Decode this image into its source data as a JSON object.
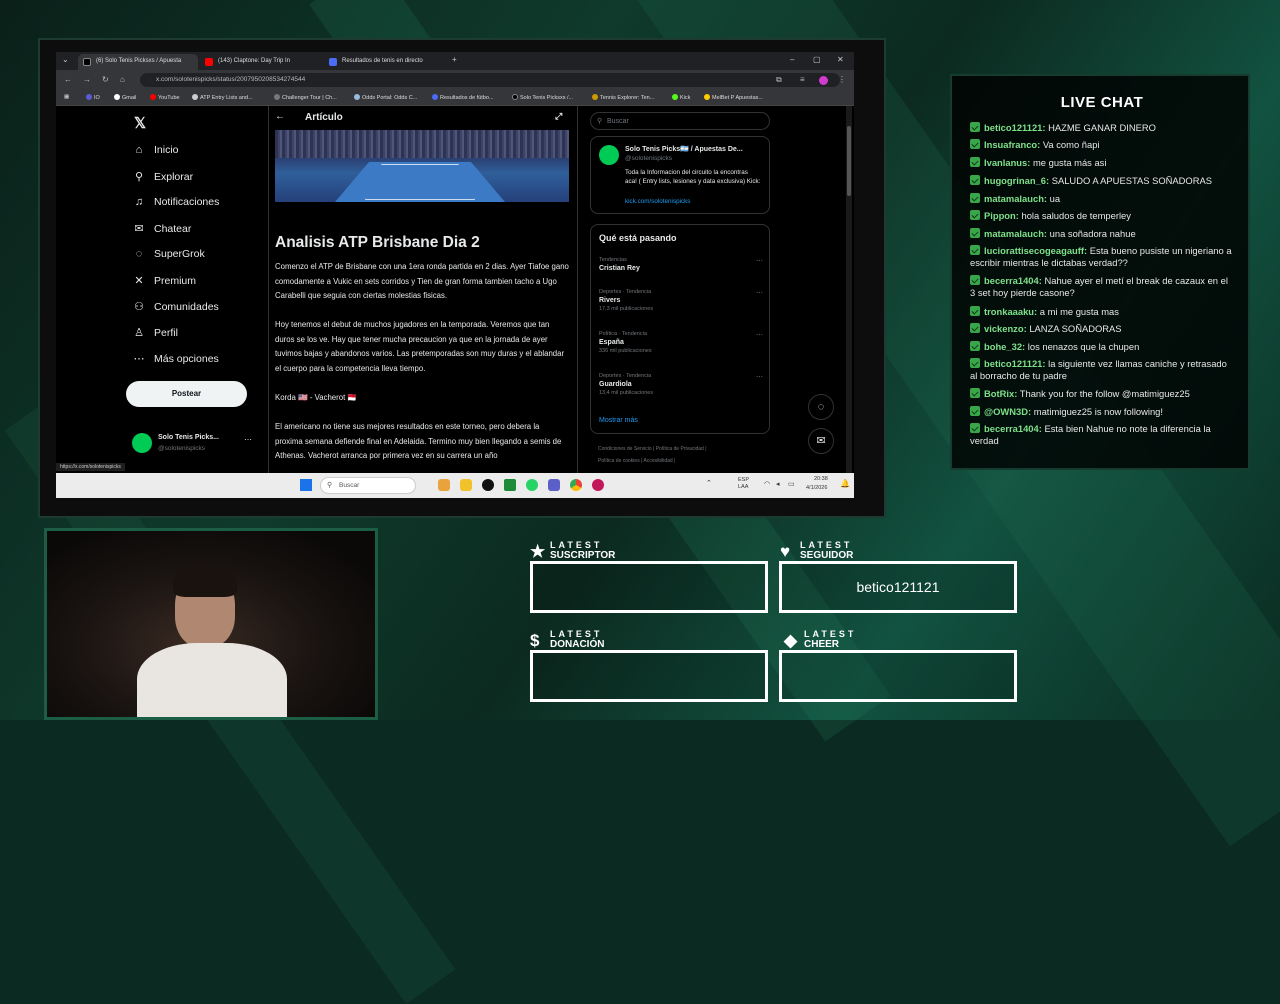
{
  "browser": {
    "tabs": [
      {
        "label": "(6) Solo Tenis Picksxs / Apuesta",
        "color": "#e7e9ea"
      },
      {
        "label": "(143) Claptone: Day Trip In",
        "color": "#ff0000"
      },
      {
        "label": "Resultados de tenis en directo",
        "color": "#4a6cf7"
      }
    ],
    "new_tab": "+",
    "url": "x.com/solotenispicks/status/2007950208534274544",
    "bookmarks": [
      "IO",
      "Gmail",
      "YouTube",
      "ATP Entry Lists and...",
      "Challenger Tour | Ch...",
      "Odds Portal: Odds C...",
      "Resultados de fútbo...",
      "Solo Tenis Picksxs /...",
      "Tennis Explorer: Ten...",
      "Kick",
      "MelBet P Apuestas..."
    ],
    "status_url": "https://x.com/solotenispicks"
  },
  "x_nav": {
    "items": [
      {
        "label": "Inicio",
        "icon": "home-icon",
        "glyph": "⌂"
      },
      {
        "label": "Explorar",
        "icon": "search-icon",
        "glyph": "⚲"
      },
      {
        "label": "Notificaciones",
        "icon": "bell-icon",
        "glyph": "🔔"
      },
      {
        "label": "Chatear",
        "icon": "mail-icon",
        "glyph": "✉"
      },
      {
        "label": "SuperGrok",
        "icon": "grok-icon",
        "glyph": "◌"
      },
      {
        "label": "Premium",
        "icon": "x-premium-icon",
        "glyph": "𝕏"
      },
      {
        "label": "Comunidades",
        "icon": "people-icon",
        "glyph": "👥"
      },
      {
        "label": "Perfil",
        "icon": "person-icon",
        "glyph": "👤"
      },
      {
        "label": "Más opciones",
        "icon": "more-icon",
        "glyph": "⋯"
      }
    ],
    "post_button": "Postear",
    "profile_name": "Solo Tenis Picks...",
    "profile_handle": "@solotenispicks"
  },
  "article": {
    "header": "Artículo",
    "title": "Analisis ATP Brisbane Dia 2",
    "p1": "Comenzo el ATP de Brisbane con una 1era ronda partida en 2 dias. Ayer Tiafoe gano comodamente a Vukic en sets corridos y Tien de gran forma tambien tacho a Ugo Carabelli que seguia con ciertas molestias fisicas.",
    "p2": "Hoy tenemos el debut de muchos jugadores en la temporada. Veremos que tan duros se los ve. Hay que tener mucha precaucion ya que en la jornada de ayer tuvimos bajas y abandonos varios. Las pretemporadas son muy duras y el ablandar el cuerpo para la competencia lleva tiempo.",
    "p3": "Korda 🇺🇸 - Vacherot 🇲🇨",
    "p4": "El americano no tiene sus mejores resultados en este torneo, pero debera la proxima semana defiende final en Adelaida. Termino muy bien llegando a semis de Athenas. Vacherot arranca por primera vez en su carrera un año"
  },
  "sidebar": {
    "search_placeholder": "Buscar",
    "profile_name": "Solo Tenis Picks🇦🇷 / Apuestas De...",
    "profile_handle": "@solotenispicks",
    "bio": "Toda la Informacion del circuito la encontras aca! ( Entry lists, lesiones y data exclusiva) Kick:",
    "bio_link": "kick.com/solotenispicks",
    "trends_title": "Qué está pasando",
    "trends": [
      {
        "category": "Tendencias",
        "name": "Cristian Rey",
        "count": ""
      },
      {
        "category": "Deportes · Tendencia",
        "name": "Rivers",
        "count": "17,3 mil publicaciones"
      },
      {
        "category": "Política · Tendencia",
        "name": "España",
        "count": "336 mil publicaciones"
      },
      {
        "category": "Deportes · Tendencia",
        "name": "Guardiola",
        "count": "13,4 mil publicaciones"
      }
    ],
    "show_more": "Mostrar más",
    "footer1": "Condiciones de Servicio  |  Política de Privacidad  |",
    "footer2": "Política de cookies  |  Accesibilidad  |"
  },
  "taskbar": {
    "search": "Buscar",
    "lang": "ESP\nLAA",
    "time": "20:38",
    "date": "4/1/2026"
  },
  "chat": {
    "title": "LIVE CHAT",
    "messages": [
      {
        "user": "betico121121:",
        "text": " HAZME GANAR DINERO"
      },
      {
        "user": "Insuafranco:",
        "text": " Va como ñapi"
      },
      {
        "user": "Ivanlanus:",
        "text": " me gusta más asi"
      },
      {
        "user": "hugogrinan_6:",
        "text": " SALUDO A APUESTAS SOÑADORAS"
      },
      {
        "user": "matamalauch:",
        "text": " ua"
      },
      {
        "user": "Pippon:",
        "text": " hola saludos de temperley"
      },
      {
        "user": "matamalauch:",
        "text": " una soñadora nahue"
      },
      {
        "user": "luciorattisecogeagauff:",
        "text": " Esta bueno pusiste un nigeriano a escribir mientras le dictabas verdad??"
      },
      {
        "user": "becerra1404:",
        "text": " Nahue ayer el metí el break de cazaux en el 3 set hoy pierde casone?"
      },
      {
        "user": "tronkaaaku:",
        "text": " a mi me gusta mas"
      },
      {
        "user": "vickenzo:",
        "text": " LANZA SOÑADORAS"
      },
      {
        "user": "bohe_32:",
        "text": " los nenazos que la chupen"
      },
      {
        "user": "betico121121:",
        "text": " la siguiente vez llamas caniche y retrasado al borracho de tu padre"
      },
      {
        "user": "BotRix:",
        "text": " Thank you for the follow @matimiguez25"
      },
      {
        "user": "@OWN3D:",
        "text": " matimiguez25 is now following!"
      },
      {
        "user": "becerra1404:",
        "text": " Esta bien Nahue no note la diferencia la verdad"
      }
    ]
  },
  "alerts": {
    "suscriptor": {
      "small": "LATEST",
      "big": "SUSCRIPTOR",
      "value": ""
    },
    "seguidor": {
      "small": "LATEST",
      "big": "SEGUIDOR",
      "value": "betico121121"
    },
    "donacion": {
      "small": "LATEST",
      "big": "DONACIÓN",
      "value": ""
    },
    "cheer": {
      "small": "LATEST",
      "big": "CHEER",
      "value": ""
    }
  }
}
